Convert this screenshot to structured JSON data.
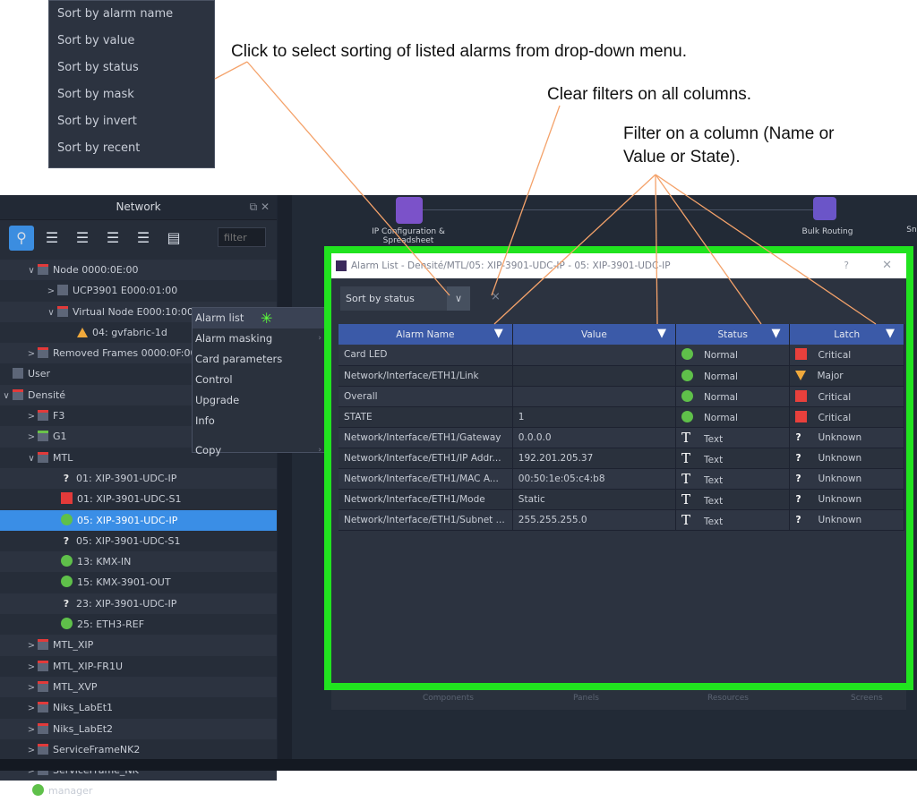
{
  "callouts": {
    "sort": "Click to select sorting of listed alarms from drop-down menu.",
    "clear": "Clear filters on all columns.",
    "filter_line1": "Filter on a column (Name or",
    "filter_line2": "Value or State)."
  },
  "sort_menu": [
    "Sort by alarm name",
    "Sort by value",
    "Sort by status",
    "Sort by mask",
    "Sort by invert",
    "Sort by recent"
  ],
  "network_panel": {
    "title": "Network",
    "filter_placeholder": "filter",
    "tree": [
      {
        "label": "Node 0000:0E:00",
        "icon": "folder-icon"
      },
      {
        "label": "UCP3901 E000:01:00",
        "icon": "device-icon"
      },
      {
        "label": "Virtual Node E000:10:00",
        "icon": "folder-icon"
      },
      {
        "label": "04: gvfabric-1d",
        "icon": "warning-icon"
      },
      {
        "label": "Removed Frames 0000:0F:00",
        "icon": "folder-icon"
      },
      {
        "label": "User",
        "icon": "device-icon"
      },
      {
        "label": "Densité",
        "icon": "folder-icon"
      },
      {
        "label": "F3",
        "icon": "folder-icon"
      },
      {
        "label": "G1",
        "icon": "folder-icon"
      },
      {
        "label": "MTL",
        "icon": "folder-icon"
      },
      {
        "label": "01: XIP-3901-UDC-IP",
        "icon": "unknown-icon"
      },
      {
        "label": "01: XIP-3901-UDC-S1",
        "icon": "critical-icon"
      },
      {
        "label": "05: XIP-3901-UDC-IP",
        "icon": "ok-icon"
      },
      {
        "label": "05: XIP-3901-UDC-S1",
        "icon": "unknown-icon"
      },
      {
        "label": "13: KMX-IN",
        "icon": "ok-icon"
      },
      {
        "label": "15: KMX-3901-OUT",
        "icon": "ok-icon"
      },
      {
        "label": "23: XIP-3901-UDC-IP",
        "icon": "unknown-icon"
      },
      {
        "label": "25: ETH3-REF",
        "icon": "ok-icon"
      },
      {
        "label": "MTL_XIP",
        "icon": "folder-icon"
      },
      {
        "label": "MTL_XIP-FR1U",
        "icon": "folder-icon"
      },
      {
        "label": "MTL_XVP",
        "icon": "folder-icon"
      },
      {
        "label": "Niks_LabEt1",
        "icon": "folder-icon"
      },
      {
        "label": "Niks_LabEt2",
        "icon": "folder-icon"
      },
      {
        "label": "ServiceFrameNK2",
        "icon": "folder-icon"
      },
      {
        "label": "ServiceFrame_NK",
        "icon": "folder-icon"
      },
      {
        "label": "manager",
        "icon": "ok-icon"
      }
    ]
  },
  "context_menu": [
    "Alarm list",
    "Alarm masking",
    "Card parameters",
    "Control",
    "Upgrade",
    "Info",
    "Copy"
  ],
  "canvas": {
    "ip_config_label": "IP Configuration & Spreadsheet",
    "bulk_routing_label": "Bulk Routing",
    "right_cut_label": "Sn",
    "bottom_tabs": [
      "Components",
      "Panels",
      "Resources",
      "Screens"
    ]
  },
  "alarm_window": {
    "title": "Alarm List - Densité/MTL/05: XIP-3901-UDC-IP - 05: XIP-3901-UDC-IP",
    "help": "?",
    "close": "✕",
    "sort_value": "Sort by status",
    "columns": [
      "Alarm Name",
      "Value",
      "Status",
      "Latch"
    ],
    "rows": [
      {
        "name": "Card LED",
        "value": "",
        "status": "Normal",
        "status_icon": "green",
        "latch": "Critical",
        "latch_icon": "red"
      },
      {
        "name": "Network/Interface/ETH1/Link",
        "value": "",
        "status": "Normal",
        "status_icon": "green",
        "latch": "Major",
        "latch_icon": "tri"
      },
      {
        "name": "Overall",
        "value": "",
        "status": "Normal",
        "status_icon": "green",
        "latch": "Critical",
        "latch_icon": "red"
      },
      {
        "name": "STATE",
        "value": "1",
        "status": "Normal",
        "status_icon": "green",
        "latch": "Critical",
        "latch_icon": "red"
      },
      {
        "name": "Network/Interface/ETH1/Gateway",
        "value": "0.0.0.0",
        "status": "Text",
        "status_icon": "T",
        "latch": "Unknown",
        "latch_icon": "Q"
      },
      {
        "name": "Network/Interface/ETH1/IP Addr...",
        "value": "192.201.205.37",
        "status": "Text",
        "status_icon": "T",
        "latch": "Unknown",
        "latch_icon": "Q"
      },
      {
        "name": "Network/Interface/ETH1/MAC A...",
        "value": "00:50:1e:05:c4:b8",
        "status": "Text",
        "status_icon": "T",
        "latch": "Unknown",
        "latch_icon": "Q"
      },
      {
        "name": "Network/Interface/ETH1/Mode",
        "value": "Static",
        "status": "Text",
        "status_icon": "T",
        "latch": "Unknown",
        "latch_icon": "Q"
      },
      {
        "name": "Network/Interface/ETH1/Subnet ...",
        "value": "255.255.255.0",
        "status": "Text",
        "status_icon": "T",
        "latch": "Unknown",
        "latch_icon": "Q"
      }
    ]
  },
  "colors": {
    "highlight_frame": "#21e31f",
    "callout_line": "#f4a26a",
    "selection": "#3a8ee6"
  }
}
